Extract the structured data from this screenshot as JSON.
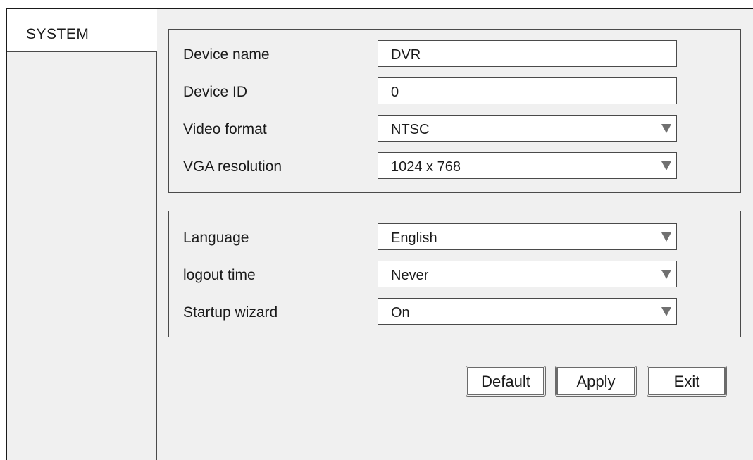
{
  "sidebar": {
    "tabs": [
      {
        "label": "SYSTEM",
        "selected": true
      }
    ]
  },
  "general": {
    "device_name": {
      "label": "Device name",
      "value": "DVR"
    },
    "device_id": {
      "label": "Device ID",
      "value": "0"
    },
    "video_format": {
      "label": "Video format",
      "value": "NTSC"
    },
    "vga_resolution": {
      "label": "VGA resolution",
      "value": "1024 x 768"
    }
  },
  "preferences": {
    "language": {
      "label": "Language",
      "value": "English"
    },
    "logout_time": {
      "label": "logout time",
      "value": "Never"
    },
    "startup_wizard": {
      "label": "Startup wizard",
      "value": "On"
    }
  },
  "buttons": {
    "default": "Default",
    "apply": "Apply",
    "exit": "Exit"
  },
  "icons": {
    "dropdown": "triangle-down-icon"
  },
  "colors": {
    "panel_bg": "#f0f0f0",
    "field_bg": "#ffffff",
    "border": "#4a4a4a",
    "arrow": "#707070"
  }
}
